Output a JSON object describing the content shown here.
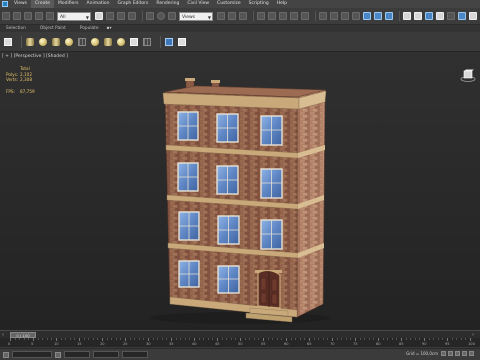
{
  "menubar": {
    "items": [
      "Views",
      "Create",
      "Modifiers",
      "Animation",
      "Graph Editors",
      "Rendering",
      "Civil View",
      "Customize",
      "Scripting",
      "Help"
    ],
    "active_index": 1
  },
  "toolbar": {
    "selection_filter": "All",
    "view_select": "Views"
  },
  "ribbon": {
    "tabs": [
      "Selection",
      "Object Paint",
      "Populate"
    ]
  },
  "viewport": {
    "label": "[ + ] [Perspective ] [Shaded ]",
    "stats": {
      "header": "Total",
      "polys_label": "Polys:",
      "polys_value": "2,102",
      "verts_label": "Verts:",
      "verts_value": "2,308",
      "fps_label": "FPS:",
      "fps_value": "87,759"
    }
  },
  "timeline": {
    "frame_display": "0 / 100"
  },
  "trackbar": {
    "ticks": [
      "0",
      "5",
      "10",
      "15",
      "20",
      "25",
      "30",
      "35",
      "40",
      "45",
      "50",
      "55",
      "60",
      "65",
      "70",
      "75",
      "80",
      "85",
      "90",
      "95",
      "100"
    ]
  },
  "statusbar": {
    "grid_readout": "Grid = 100,0cm"
  },
  "colors": {
    "brick": "#8a5a45",
    "trim": "#c9a97a",
    "window": "#5f86c4",
    "door": "#5a2e25",
    "stats_text": "#e6c36a"
  }
}
